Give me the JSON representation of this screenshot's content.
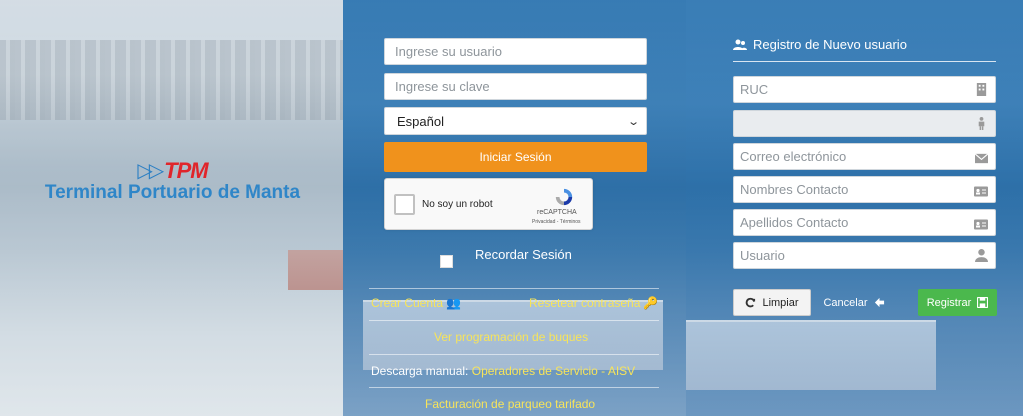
{
  "logo": {
    "mark": "TPM",
    "name": "Terminal Portuario de Manta"
  },
  "login": {
    "username_placeholder": "Ingrese su usuario",
    "password_placeholder": "Ingrese su clave",
    "language_selected": "Español",
    "submit_label": "Iniciar Sesión",
    "remember_label": "Recordar Sesión"
  },
  "captcha": {
    "label": "No soy un robot",
    "brand": "reCAPTCHA",
    "terms": "Privacidad - Términos"
  },
  "links": {
    "create_account": "Crear Cuenta",
    "reset_password": "Resetear contraseña",
    "ship_schedule": "Ver programación de buques",
    "manual_prefix": "Descarga manual:",
    "manual_operators": "Operadores de Servicio",
    "manual_separator": "-",
    "manual_aisv": "AISV",
    "parking_billing": "Facturación de parqueo tarifado"
  },
  "register": {
    "title": "Registro de Nuevo usuario",
    "ruc_placeholder": "RUC",
    "name_placeholder": "",
    "email_placeholder": "Correo electrónico",
    "contact_names_placeholder": "Nombres Contacto",
    "contact_lastnames_placeholder": "Apellidos Contacto",
    "user_placeholder": "Usuario",
    "clear_label": "Limpiar",
    "cancel_label": "Cancelar",
    "register_label": "Registrar"
  },
  "colors": {
    "login_button": "#f0921c",
    "register_button": "#4bb84d",
    "link_yellow": "#f7e45a",
    "logo_blue": "#2f86c8",
    "logo_red": "#e0252b"
  }
}
